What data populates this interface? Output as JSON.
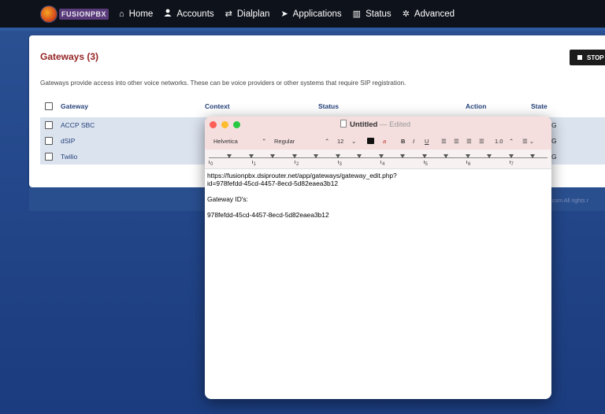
{
  "topnav": {
    "brand": "FUSIONPBX",
    "items": [
      {
        "icon": "home-icon",
        "glyph": "⌂",
        "label": "Home"
      },
      {
        "icon": "user-icon",
        "glyph": "👤",
        "label": "Accounts"
      },
      {
        "icon": "exchange-icon",
        "glyph": "⇄",
        "label": "Dialplan"
      },
      {
        "icon": "paper-plane-icon",
        "glyph": "➤",
        "label": "Applications"
      },
      {
        "icon": "chart-icon",
        "glyph": "▥",
        "label": "Status"
      },
      {
        "icon": "gear-icon",
        "glyph": "✲",
        "label": "Advanced"
      }
    ]
  },
  "gateways": {
    "title": "Gateways (3)",
    "stop_label": "STOP",
    "description": "Gateways provide access into other voice networks. These can be voice providers or other systems that require SIP registration.",
    "columns": {
      "gateway": "Gateway",
      "context": "Context",
      "status": "Status",
      "action": "Action",
      "state": "State"
    },
    "rows": [
      {
        "name": "ACCP SBC",
        "state_fragment": "G"
      },
      {
        "name": "dSIP",
        "state_fragment": "G"
      },
      {
        "name": "Twilio",
        "state_fragment": "G"
      }
    ],
    "footer": "ibx.com All rights r"
  },
  "textedit": {
    "title": "Untitled",
    "edited": "— Edited",
    "font": "Helvetica",
    "style": "Regular",
    "size": "12",
    "bold": "B",
    "italic": "I",
    "underline": "U",
    "spacing": "1.0",
    "ruler_numbers": [
      "0",
      "1",
      "2",
      "3",
      "4",
      "5",
      "6",
      "7"
    ],
    "lines": [
      "https://fusionpbx.dsiprouter.net/app/gateways/gateway_edit.php?",
      "id=978fefdd-45cd-4457-8ecd-5d82eaea3b12",
      "",
      "Gateway ID's:",
      "",
      "978fefdd-45cd-4457-8ecd-5d82eaea3b12"
    ]
  },
  "colors": {
    "nav_bg": "#0e121a",
    "title_red": "#952424",
    "link_blue": "#26427a",
    "row_bg": "#dbe3ef"
  }
}
